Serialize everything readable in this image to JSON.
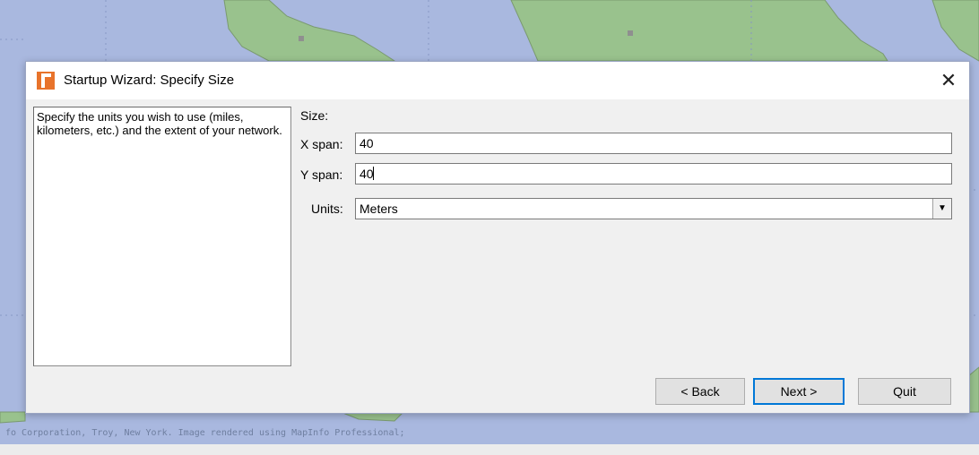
{
  "background": {
    "credit_text": "fo Corporation, Troy, New York. Image rendered using MapInfo Professional;",
    "ocean_color": "#a9b8df",
    "land_color": "#99c28d"
  },
  "dialog": {
    "title": "Startup Wizard: Specify Size",
    "app_icon": "mapinfo-icon",
    "close_glyph": "✕",
    "description": "Specify the units you wish to use (miles, kilometers, etc.) and  the extent of your network.",
    "size_label": "Size:",
    "x_span": {
      "label": "X span:",
      "value": "40"
    },
    "y_span": {
      "label": "Y span:",
      "value": "40"
    },
    "units": {
      "label": "Units:",
      "value": "Meters",
      "arrow": "▼"
    },
    "buttons": {
      "back": "< Back",
      "next": "Next >",
      "quit": "Quit"
    }
  }
}
